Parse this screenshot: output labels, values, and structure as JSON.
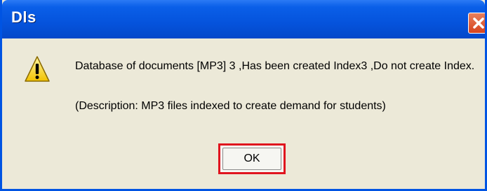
{
  "window": {
    "title": "Dls",
    "close_icon": "close-icon"
  },
  "dialog": {
    "icon": "warning-icon",
    "message": "Database of documents [MP3] 3 ,Has been created Index3 ,Do not create Index.",
    "description": "(Description: MP3 files indexed to create demand for students)",
    "ok_label": "OK",
    "highlight_color": "#e0141e"
  }
}
